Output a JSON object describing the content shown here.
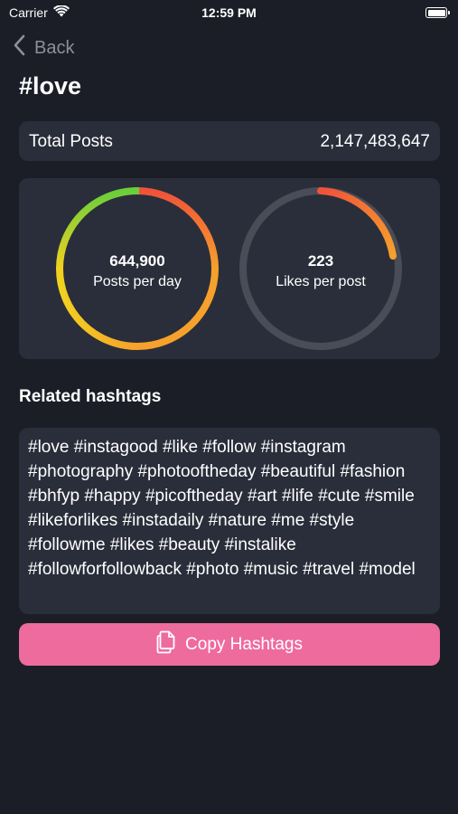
{
  "status_bar": {
    "carrier": "Carrier",
    "time": "12:59 PM"
  },
  "nav": {
    "back_label": "Back"
  },
  "page": {
    "title": "#love"
  },
  "total": {
    "label": "Total Posts",
    "value": "2,147,483,647"
  },
  "stats": {
    "posts_per_day": {
      "value": "644,900",
      "label": "Posts per day",
      "fill_fraction": 1.0
    },
    "likes_per_post": {
      "value": "223",
      "label": "Likes per post",
      "fill_fraction": 0.22
    }
  },
  "related": {
    "title": "Related hashtags",
    "tags_text": "#love #instagood #like #follow #instagram #photography #photooftheday #beautiful #fashion #bhfyp #happy #picoftheday #art #life #cute #smile #likeforlikes #instadaily #nature #me #style #followme #likes #beauty #instalike #followforfollowback #photo #music #travel #model"
  },
  "copy_button": {
    "label": "Copy Hashtags"
  },
  "colors": {
    "background": "#1b1e27",
    "card": "#2a2e3a",
    "accent": "#ee6b9e",
    "ring_track": "#4a4d57",
    "ring_red": "#f0523a",
    "ring_orange": "#f6a12b",
    "ring_yellow": "#f2d21f",
    "ring_green": "#69cf3b"
  },
  "icons": {
    "wifi": "wifi-icon",
    "battery": "battery-icon",
    "back": "chevron-left-icon",
    "copy": "copy-icon"
  }
}
